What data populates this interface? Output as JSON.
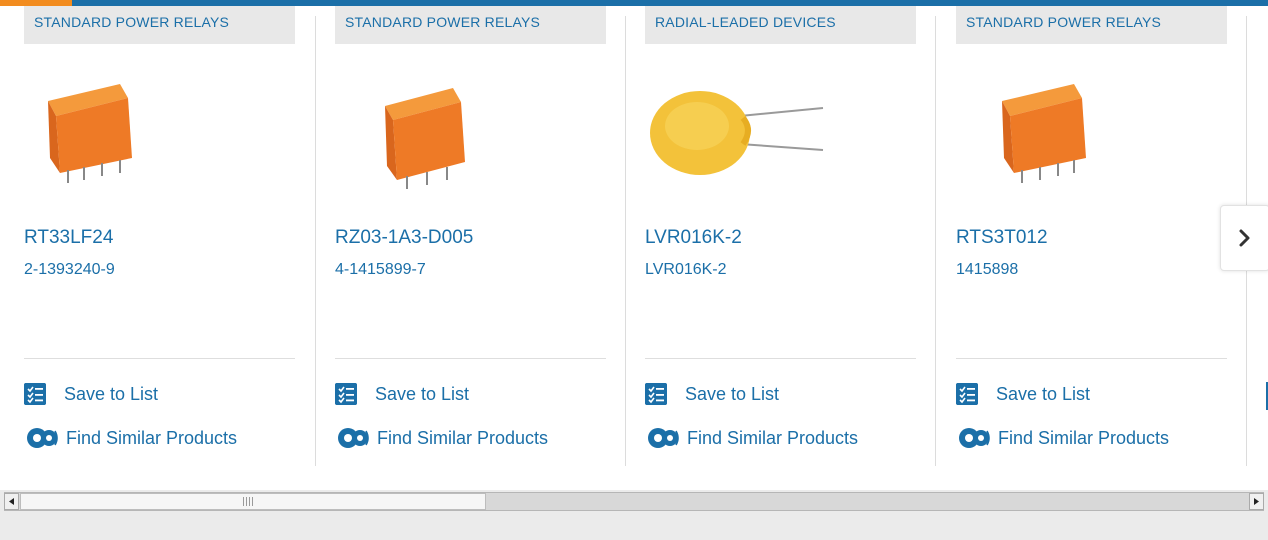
{
  "theme": {
    "accent": "#1b6fa8",
    "highlight": "#f28c1f",
    "banner_bg": "#e8e8e8"
  },
  "products": [
    {
      "category": "STANDARD POWER RELAYS",
      "name": "RT33LF24",
      "part_number": "2-1393240-9",
      "image": "orange-relay",
      "save_label": "Save to List",
      "similar_label": "Find Similar Products"
    },
    {
      "category": "STANDARD POWER RELAYS",
      "name": "RZ03-1A3-D005",
      "part_number": "4-1415899-7",
      "image": "orange-relay",
      "save_label": "Save to List",
      "similar_label": "Find Similar Products"
    },
    {
      "category": "RADIAL-LEADED DEVICES",
      "name": "LVR016K-2",
      "part_number": "LVR016K-2",
      "image": "yellow-radial-device",
      "save_label": "Save to List",
      "similar_label": "Find Similar Products"
    },
    {
      "category": "STANDARD POWER RELAYS",
      "name": "RTS3T012",
      "part_number": "1415898",
      "image": "orange-relay",
      "save_label": "Save to List",
      "similar_label": "Find Similar Products"
    }
  ],
  "navigation": {
    "next_icon": "chevron-right-icon"
  },
  "scrollbar": {
    "position_fraction": 0.0,
    "visible_fraction": 0.37
  }
}
